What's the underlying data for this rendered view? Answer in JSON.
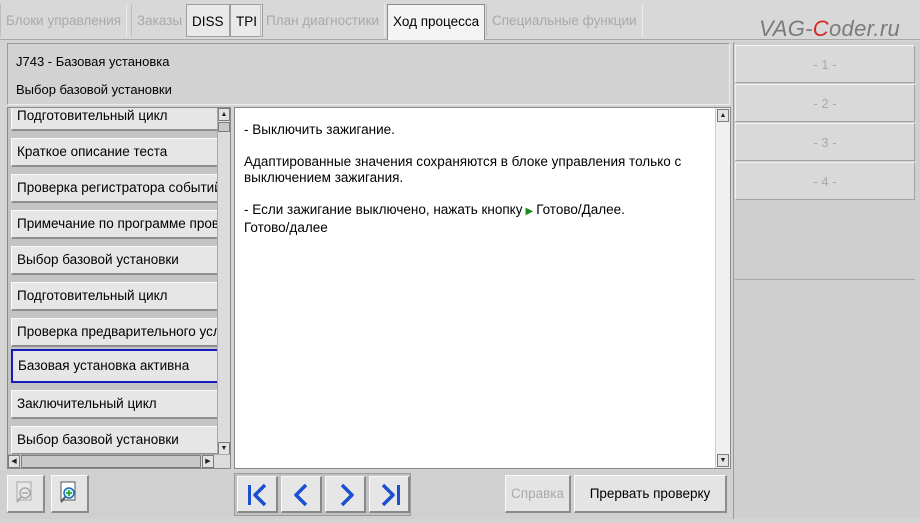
{
  "tabs": [
    {
      "label": "Блоки управления",
      "state": "disabled"
    },
    {
      "label": "Заказы",
      "state": "disabled"
    },
    {
      "label": "DISS",
      "state": "enabled"
    },
    {
      "label": "TPI",
      "state": "enabled"
    },
    {
      "label": "План диагностики",
      "state": "disabled"
    },
    {
      "label": "Ход процесса",
      "state": "active"
    },
    {
      "label": "Специальные функции",
      "state": "disabled"
    }
  ],
  "watermark": {
    "pre": "VAG-",
    "accent": "C",
    "post": "oder.ru"
  },
  "header": {
    "line1": "J743 - Базовая установка",
    "line2": "Выбор базовой установки"
  },
  "steps": [
    {
      "label": "Подготовительный цикл"
    },
    {
      "label": "Краткое описание теста"
    },
    {
      "label": "Проверка регистратора событий"
    },
    {
      "label": "Примечание по программе проверки"
    },
    {
      "label": "Выбор базовой установки"
    },
    {
      "label": "Подготовительный цикл"
    },
    {
      "label": "Проверка предварительного условия"
    },
    {
      "label": "Базовая установка активна",
      "selected": true
    },
    {
      "label": "Заключительный цикл"
    },
    {
      "label": "Выбор базовой установки"
    }
  ],
  "content": {
    "p1": "- Выключить зажигание.",
    "p2": "Адаптированные значения сохраняются в блоке управления только с выключением зажигания.",
    "p3_prefix": "- Если зажигание выключено, нажать кнопку",
    "p3_suffix": "Готово/Далее.",
    "p3_line2": "Готово/далее"
  },
  "right_buttons": [
    "- 1 -",
    "- 2 -",
    "- 3 -",
    "- 4 -"
  ],
  "toolbar": {
    "help_label": "Справка",
    "abort_label": "Прервать проверку"
  },
  "colors": {
    "selection": "#1a1ab8",
    "nav_icon": "#1c4fd0",
    "arrow": "#1e8a1e",
    "watermark_accent": "#d42a2a"
  }
}
